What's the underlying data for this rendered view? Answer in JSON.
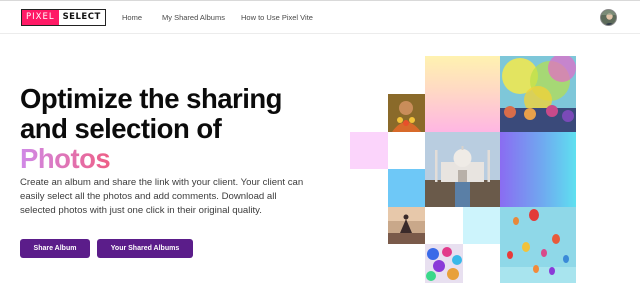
{
  "brand": {
    "logo_part1": "PIXEL",
    "logo_part2": "SELECT"
  },
  "nav": {
    "links": [
      {
        "label": "Home"
      },
      {
        "label": "My Shared Albums"
      },
      {
        "label": "How to Use Pixel Vite"
      }
    ]
  },
  "hero": {
    "headline_line1": "Optimize the sharing",
    "headline_line2": "and selection of",
    "headline_accent": "Photos",
    "description": "Create an album and share the link with your client. Your client can easily select all the photos and add comments. Download all selected photos with just one click in their original quality.",
    "primary_button": "Share Album",
    "secondary_button": "Your Shared Albums"
  },
  "colors": {
    "accent_gradient_start": "#d08ae8",
    "accent_gradient_end": "#ee5f86",
    "button_bg": "#5b1d8a",
    "logo_pink": "#ff1a66"
  },
  "collage": {
    "tiles": [
      {
        "name": "gradient-yellow-pink-tile"
      },
      {
        "name": "holi-crowd-photo"
      },
      {
        "name": "man-with-garland-photo"
      },
      {
        "name": "pink-square-tile"
      },
      {
        "name": "taj-mahal-photo"
      },
      {
        "name": "purple-blue-gradient-tile"
      },
      {
        "name": "light-blue-square-tile"
      },
      {
        "name": "yoga-sunset-photo"
      },
      {
        "name": "pale-cyan-square-tile"
      },
      {
        "name": "hot-air-balloons-photo"
      },
      {
        "name": "colorful-festival-photo"
      }
    ]
  }
}
